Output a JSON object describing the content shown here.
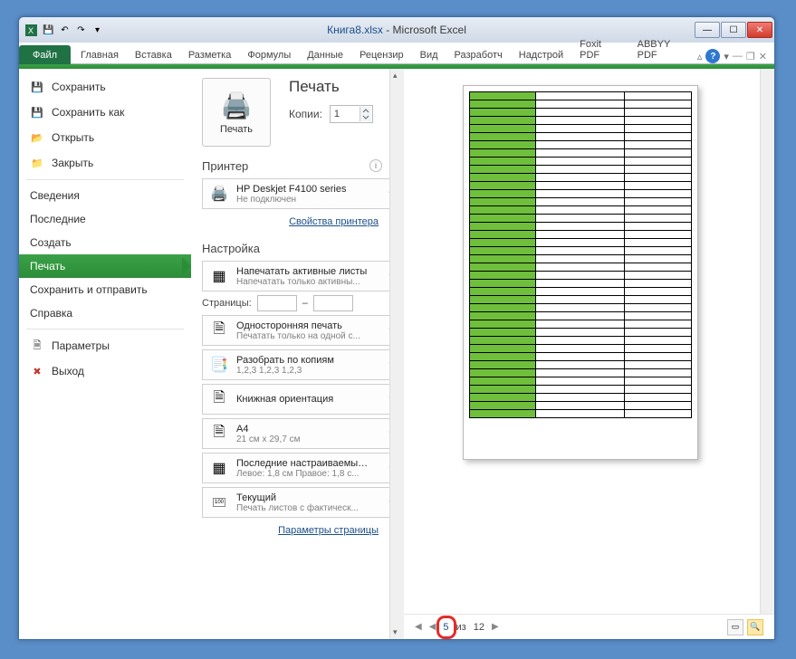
{
  "title": {
    "file": "Книга8.xlsx",
    "sep": " - ",
    "app": "Microsoft Excel"
  },
  "qat": {
    "save": "💾",
    "undo": "↶",
    "redo": "↷",
    "dd": "▾"
  },
  "win": {
    "min": "—",
    "max": "☐",
    "close": "✕"
  },
  "tabs": {
    "file": "Файл",
    "items": [
      "Главная",
      "Вставка",
      "Разметка",
      "Формулы",
      "Данные",
      "Рецензир",
      "Вид",
      "Разработч",
      "Надстрой",
      "Foxit PDF",
      "ABBYY PDF"
    ],
    "chev": "▵"
  },
  "nav": {
    "save": "Сохранить",
    "saveas": "Сохранить как",
    "open": "Открыть",
    "close_file": "Закрыть",
    "info": "Сведения",
    "recent": "Последние",
    "new": "Создать",
    "print": "Печать",
    "sendsave": "Сохранить и отправить",
    "help": "Справка",
    "options": "Параметры",
    "exit": "Выход"
  },
  "print": {
    "title": "Печать",
    "button": "Печать",
    "copies_label": "Копии:",
    "copies_value": "1",
    "printer_section": "Принтер",
    "printer_name": "HP Deskjet F4100 series",
    "printer_status": "Не подключен",
    "printer_props": "Свойства принтера",
    "settings_section": "Настройка",
    "active_sheets_title": "Напечатать активные листы",
    "active_sheets_sub": "Напечатать только активны...",
    "pages_label": "Страницы:",
    "pages_sep": "–",
    "onesided_title": "Односторонняя печать",
    "onesided_sub": "Печатать только на одной с...",
    "collate_title": "Разобрать по копиям",
    "collate_sub": "1,2,3   1,2,3   1,2,3",
    "orientation_title": "Книжная ориентация",
    "paper_title": "A4",
    "paper_sub": "21 см x 29,7 см",
    "margins_title": "Последние настраиваемые ...",
    "margins_sub": "Левое: 1,8 см   Правое: 1,8 с...",
    "scaling_title": "Текущий",
    "scaling_sub": "Печать листов с фактическ...",
    "page_setup": "Параметры страницы"
  },
  "pager": {
    "prev": "◀",
    "current": "5",
    "of_label": "из",
    "total": "12",
    "next": "▶"
  }
}
